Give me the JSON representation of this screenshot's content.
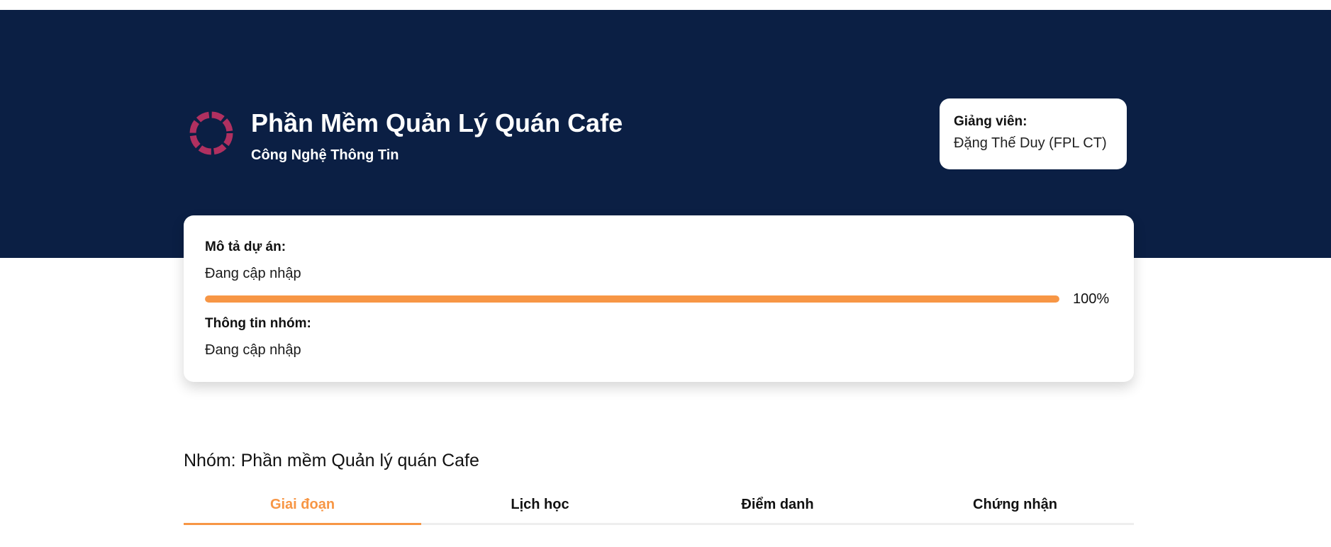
{
  "project": {
    "title": "Phần Mềm Quản Lý Quán Cafe",
    "subtitle": "Công Nghệ Thông Tin",
    "icon": "spinner-icon"
  },
  "teacher": {
    "label": "Giảng viên:",
    "name": "Đặng Thế Duy (FPL CT)"
  },
  "info": {
    "description_label": "Mô tả dự án:",
    "description_value": "Đang cập nhập",
    "progress_value": 100,
    "progress_text": "100%",
    "group_info_label": "Thông tin nhóm:",
    "group_info_value": "Đang cập nhập"
  },
  "group": {
    "title": "Nhóm: Phần mềm Quản lý quán Cafe"
  },
  "tabs": [
    {
      "label": "Giai đoạn",
      "active": true
    },
    {
      "label": "Lịch học",
      "active": false
    },
    {
      "label": "Điểm danh",
      "active": false
    },
    {
      "label": "Chứng nhận",
      "active": false
    }
  ],
  "colors": {
    "header_bg": "#0b1f44",
    "accent": "#f79645",
    "icon": "#b03060"
  }
}
